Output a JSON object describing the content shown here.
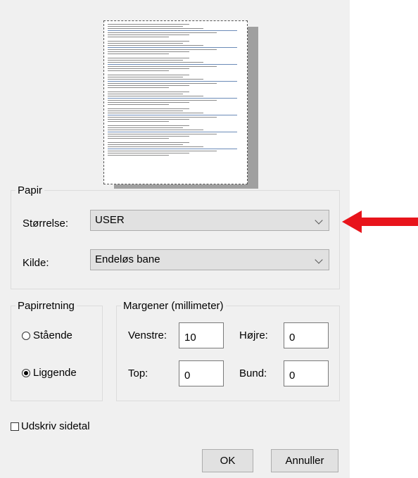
{
  "paper": {
    "legend": "Papir",
    "size_label": "Størrelse:",
    "size_value": "USER",
    "source_label": "Kilde:",
    "source_value": "Endeløs bane"
  },
  "orientation": {
    "legend": "Papirretning",
    "portrait_label": "Stående",
    "portrait_selected": false,
    "landscape_label": "Liggende",
    "landscape_selected": true
  },
  "margins": {
    "legend": "Margener (millimeter)",
    "left_label": "Venstre:",
    "left_value": "10",
    "right_label": "Højre:",
    "right_value": "0",
    "top_label": "Top:",
    "top_value": "0",
    "bottom_label": "Bund:",
    "bottom_value": "0"
  },
  "print_page_numbers": {
    "label": "Udskriv sidetal",
    "checked": false
  },
  "buttons": {
    "ok": "OK",
    "cancel": "Annuller"
  },
  "colors": {
    "dialog_bg": "#f0f0f0",
    "annotation_arrow": "#e8141b"
  },
  "icons": {
    "dropdown": "chevron-down-icon",
    "annotation": "red-arrow-left"
  }
}
